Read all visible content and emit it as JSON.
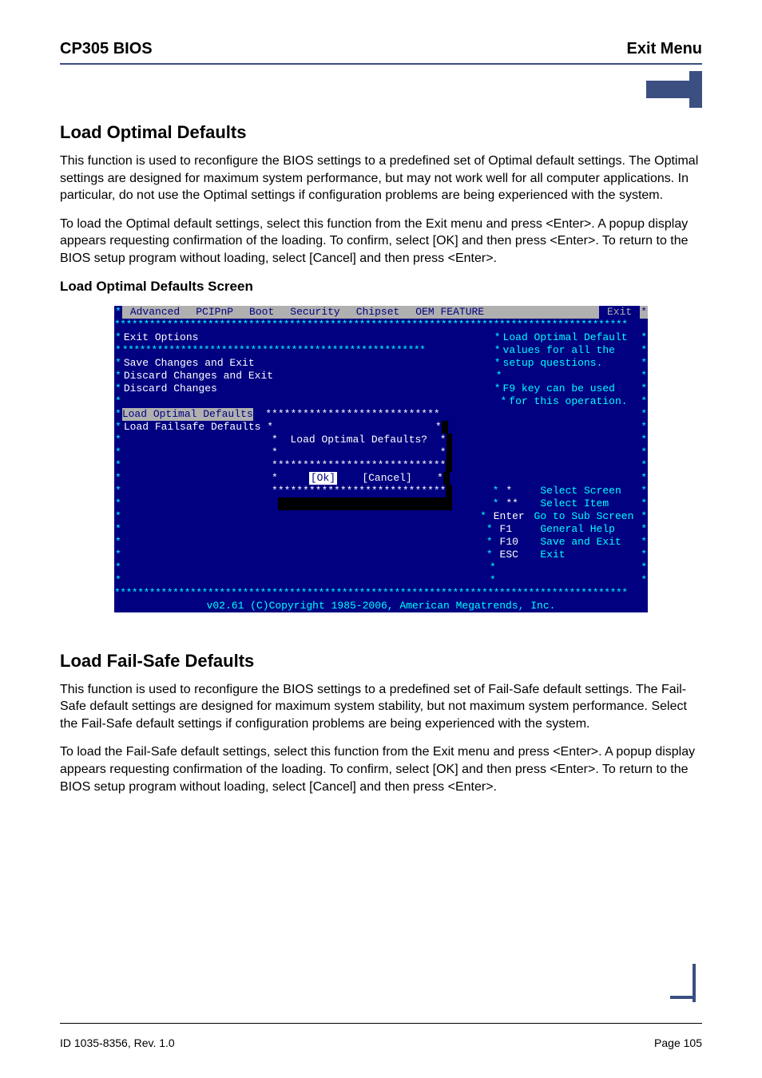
{
  "header": {
    "left": "CP305 BIOS",
    "right": "Exit Menu"
  },
  "section1": {
    "title": "Load Optimal Defaults",
    "para1": "This function is used to reconfigure the BIOS settings to a predefined set of Optimal default settings. The Optimal settings are designed for maximum system performance, but may not work well for all computer applications. In particular, do not use the Optimal settings if configuration problems are being experienced with the system.",
    "para2": "To load the Optimal default settings, select this function from the Exit menu and press <Enter>. A popup display appears requesting confirmation of the loading. To confirm, select [OK] and then press <Enter>. To return to the BIOS setup program without loading, select [Cancel] and then press <Enter>.",
    "subhead": "Load Optimal Defaults Screen"
  },
  "bios": {
    "menu": [
      "Advanced",
      "PCIPnP",
      "Boot",
      "Security",
      "Chipset",
      "OEM FEATURE",
      "Exit"
    ],
    "selectedMenuIndex": 6,
    "leftTitle": "Exit Options",
    "leftItems": [
      "Save Changes and Exit",
      "Discard Changes and Exit",
      "Discard Changes",
      "",
      "Load Optimal Defaults",
      "Load Failsafe Defaults"
    ],
    "selectedItem": "Load Optimal Defaults",
    "help": [
      "Load Optimal Default",
      "values for all the",
      "setup questions.",
      "",
      "F9 key can be used",
      "for this operation."
    ],
    "nav": [
      {
        "key": "*",
        "label": "Select Screen"
      },
      {
        "key": "**",
        "label": "Select Item"
      },
      {
        "key": "Enter",
        "label": "Go to Sub Screen"
      },
      {
        "key": "F1",
        "label": "General Help"
      },
      {
        "key": "F10",
        "label": "Save and Exit"
      },
      {
        "key": "ESC",
        "label": "Exit"
      }
    ],
    "popup": {
      "question": "Load Optimal Defaults?",
      "ok": "[Ok]",
      "cancel": "[Cancel]"
    },
    "copyright": "v02.61 (C)Copyright 1985-2006, American Megatrends, Inc."
  },
  "section2": {
    "title": "Load Fail-Safe Defaults",
    "para1": "This function is used to reconfigure the BIOS settings to a predefined set of Fail-Safe default settings. The Fail-Safe default settings are designed for maximum system stability, but not maximum system performance. Select the Fail-Safe default settings if configuration problems are being experienced with the system.",
    "para2": "To load the Fail-Safe default settings, select this function from the Exit menu and press <Enter>. A popup display appears requesting confirmation of the loading. To confirm, select [OK] and then press <Enter>. To return to the BIOS setup program without loading, select [Cancel] and then press <Enter>."
  },
  "footer": {
    "left": "ID 1035-8356, Rev. 1.0",
    "right": "Page 105"
  }
}
